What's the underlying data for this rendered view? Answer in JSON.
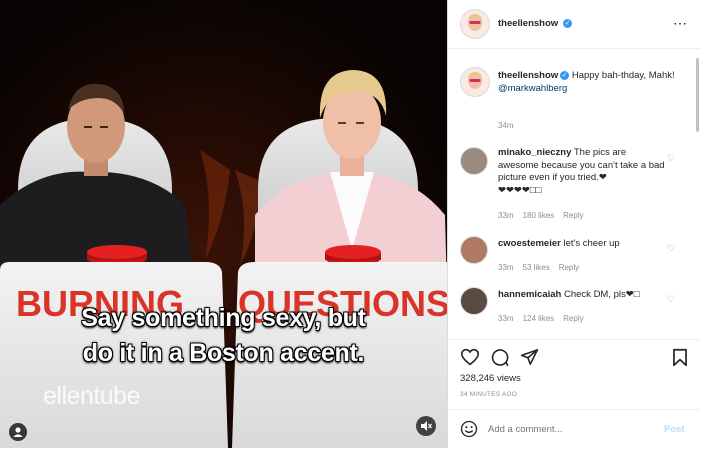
{
  "video": {
    "caption_lines": [
      "Say something sexy, but",
      "do it in a Boston accent."
    ],
    "sign_left": "BURNING",
    "sign_right": "QUESTIONS",
    "watermark": "ellentube"
  },
  "post_header": {
    "username": "theellenshow",
    "verified": true,
    "more_icon": "ellipsis-icon"
  },
  "caption": {
    "username": "theellenshow",
    "text": "Happy bah-thday, Mahk!",
    "mention": "@markwahlberg",
    "time": "34m"
  },
  "comments": [
    {
      "username": "minako_nieczny",
      "text": "The pics are awesome because you can't take a bad picture even if you tried.❤",
      "text_line2": "❤❤❤❤□□",
      "time": "33m",
      "likes": "180 likes",
      "reply": "Reply"
    },
    {
      "username": "cwoestemeier",
      "text": "let's cheer up",
      "time": "33m",
      "likes": "53 likes",
      "reply": "Reply"
    },
    {
      "username": "hannemicaiah",
      "text": "Check DM, pls❤□",
      "time": "33m",
      "likes": "124 likes",
      "reply": "Reply"
    }
  ],
  "actions": {
    "views": "328,246 views",
    "timestamp": "34 MINUTES AGO"
  },
  "add_comment": {
    "placeholder": "Add a comment...",
    "post_label": "Post"
  },
  "colors": {
    "verified": "#3897f0",
    "link": "#00376b",
    "muted_text": "#8e8e8e",
    "post_disabled": "#b2dffc"
  }
}
